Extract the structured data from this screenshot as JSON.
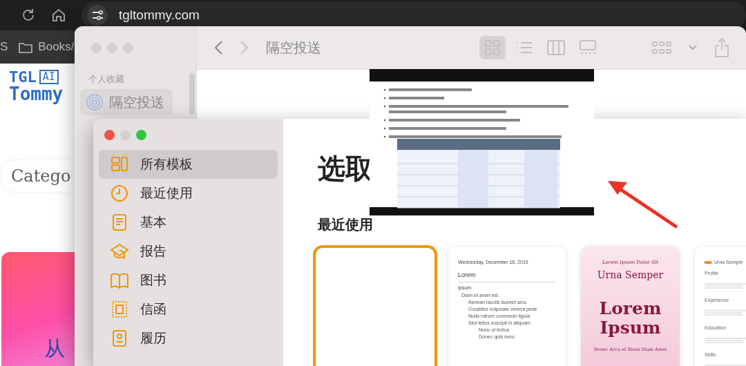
{
  "browser": {
    "url": "tgltommy.com",
    "bookmarks": [
      {
        "label": "S",
        "kind": "text"
      },
      {
        "label": "Books/",
        "kind": "folder"
      }
    ]
  },
  "website": {
    "logo": {
      "line1": "TGL",
      "chip": "AI",
      "line2": "Tommy"
    },
    "search": {
      "placeholder": "Catego"
    },
    "banner": {
      "lines": [
        "从"
      ]
    }
  },
  "finder": {
    "title": "隔空投送",
    "sidebar": {
      "section": "个人收藏",
      "items": [
        {
          "label": "隔空投送",
          "selected": true
        }
      ]
    },
    "views": [
      {
        "kind": "grid",
        "selected": true
      },
      {
        "kind": "list",
        "selected": false
      },
      {
        "kind": "columns",
        "selected": false
      },
      {
        "kind": "gallery",
        "selected": false
      }
    ]
  },
  "pages": {
    "heading": "选取",
    "section": "最近使用",
    "sidebar": [
      {
        "label": "所有模板",
        "kind": "all",
        "selected": true
      },
      {
        "label": "最近使用",
        "kind": "clock",
        "selected": false
      },
      {
        "label": "基本",
        "kind": "doc",
        "selected": false
      },
      {
        "label": "报告",
        "kind": "cap",
        "selected": false
      },
      {
        "label": "图书",
        "kind": "book",
        "selected": false
      },
      {
        "label": "信函",
        "kind": "stamp",
        "selected": false
      },
      {
        "label": "履历",
        "kind": "person",
        "selected": false
      }
    ],
    "templates": [
      {
        "kind": "blank",
        "selected": true
      },
      {
        "kind": "note",
        "selected": false,
        "date": "Wednesday, December 16, 2019",
        "title": "Lorem",
        "subtitle": "Ipsum",
        "bullets": [
          {
            "text": "Diam et amet est",
            "children": [
              {
                "text": "Aenean iaculis laoreet arcu"
              },
              {
                "text": "Curabitur vulputate viverra pede"
              },
              {
                "text": "Nulla rutrum commodo ligula"
              },
              {
                "text": "Sed tellus suscipit in aliquam",
                "children": [
                  {
                    "text": "Nunc ut lectus"
                  },
                  {
                    "text": "Donec quis nunc"
                  }
                ]
              }
            ]
          }
        ]
      },
      {
        "kind": "cover",
        "selected": false,
        "kicker": "Lorem Ipsum Dolor Sit",
        "name": "Urna Semper",
        "title": "Lorem Ipsum",
        "subtitle": "Donec Arcu et Risus Diam Amet"
      },
      {
        "kind": "resume",
        "selected": false,
        "name": "Urna Semper",
        "sections": [
          "Profile",
          "Experience",
          "Education",
          "Skills"
        ]
      }
    ]
  }
}
